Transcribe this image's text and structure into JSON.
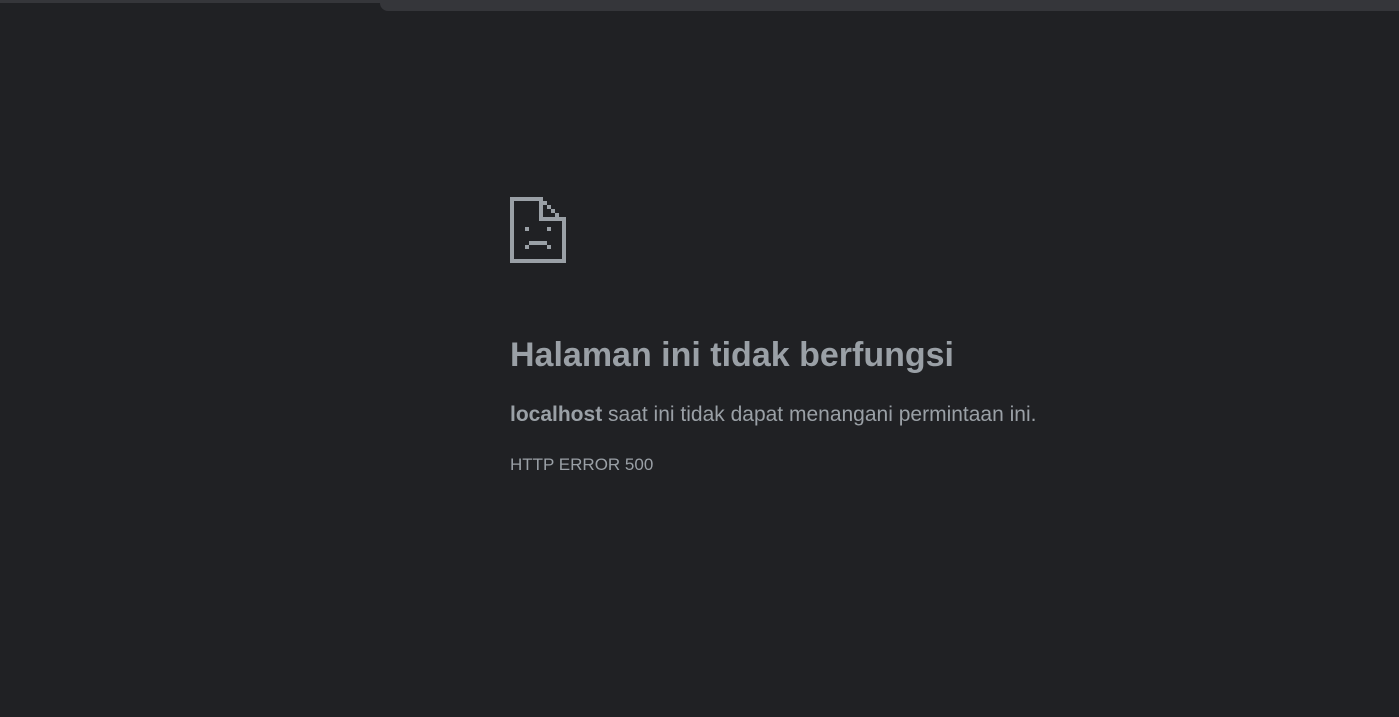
{
  "error_page": {
    "icon": "sad-file-icon",
    "headline": "Halaman ini tidak berfungsi",
    "host": "localhost",
    "message": " saat ini tidak dapat menangani permintaan ini.",
    "error_code": "HTTP ERROR 500"
  },
  "colors": {
    "background": "#202124",
    "text": "#9aa0a6",
    "top_bar": "#35363a"
  }
}
